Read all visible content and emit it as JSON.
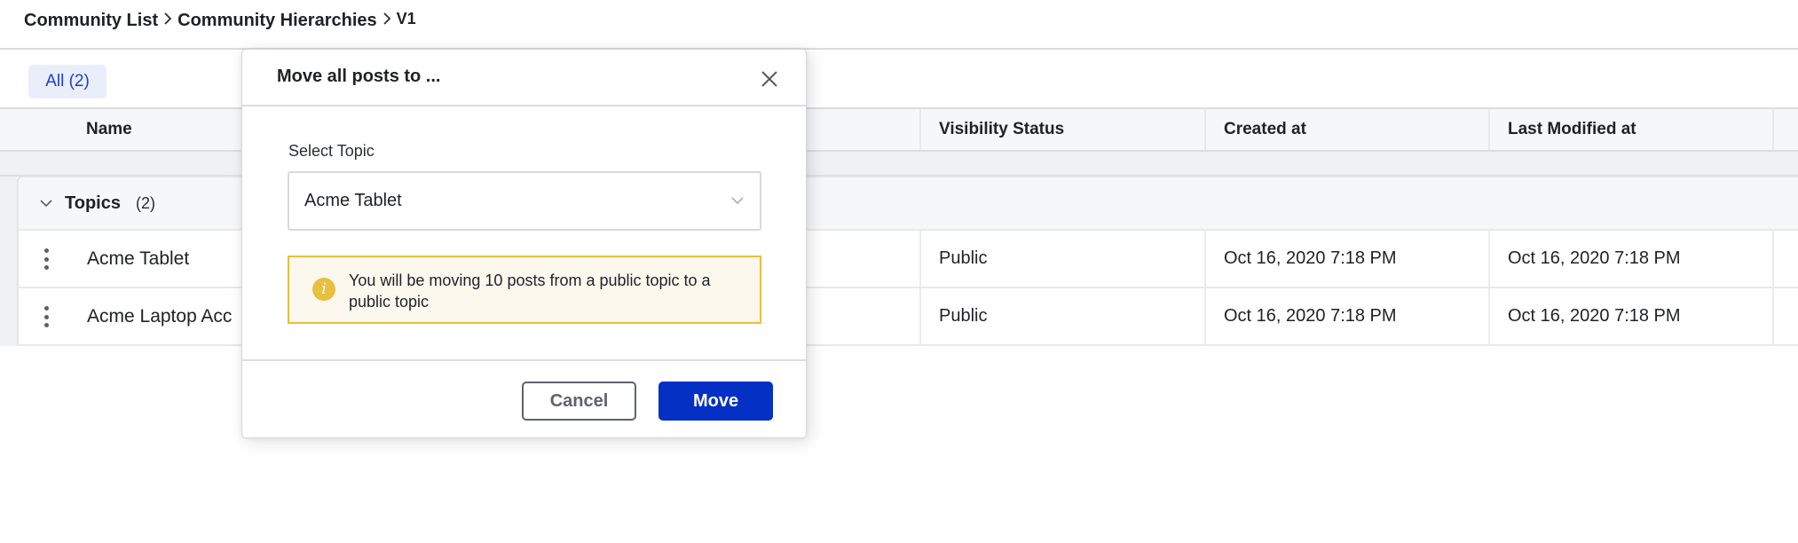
{
  "breadcrumb": {
    "items": [
      "Community List",
      "Community Hierarchies"
    ],
    "current": "V1",
    "separator_icon": "chevron-right-icon"
  },
  "tabs": [
    {
      "label": "All (2)",
      "active": true
    }
  ],
  "table": {
    "columns": [
      "Name",
      "Visibility Status",
      "Created at",
      "Last Modified at"
    ],
    "group": {
      "title": "Topics",
      "count": "(2)",
      "expanded": true
    },
    "rows": [
      {
        "name": "Acme Tablet",
        "visibility": "Public",
        "created_at": "Oct 16, 2020 7:18 PM",
        "modified_at": "Oct 16, 2020 7:18 PM"
      },
      {
        "name": "Acme Laptop Acc",
        "visibility": "Public",
        "created_at": "Oct 16, 2020 7:18 PM",
        "modified_at": "Oct 16, 2020 7:18 PM"
      }
    ]
  },
  "modal": {
    "title": "Move all posts to ...",
    "field_label": "Select Topic",
    "selected_topic": "Acme Tablet",
    "alert_text": "You will be moving 10 posts from a public topic to a public topic",
    "alert_icon": "i",
    "cancel_label": "Cancel",
    "move_label": "Move"
  },
  "colors": {
    "primary": "#0530c4",
    "chip_bg": "#eaeefa",
    "chip_text": "#1b3ec8",
    "warning_border": "#e6c03c",
    "warning_bg": "#fcf8ee",
    "warning_icon": "#e8c040"
  }
}
